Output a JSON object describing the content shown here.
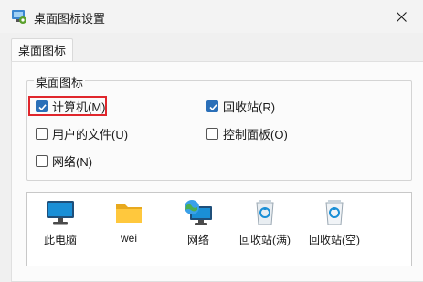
{
  "window": {
    "title": "桌面图标设置"
  },
  "tabs": [
    {
      "label": "桌面图标"
    }
  ],
  "group": {
    "title": "桌面图标",
    "checkboxes": [
      {
        "label": "计算机(M)",
        "checked": true
      },
      {
        "label": "回收站(R)",
        "checked": true
      },
      {
        "label": "用户的文件(U)",
        "checked": false
      },
      {
        "label": "控制面板(O)",
        "checked": false
      },
      {
        "label": "网络(N)",
        "checked": false
      }
    ]
  },
  "icons": [
    {
      "label": "此电脑",
      "icon": "monitor-icon"
    },
    {
      "label": "wei",
      "icon": "folder-icon"
    },
    {
      "label": "网络",
      "icon": "network-globe-icon"
    },
    {
      "label": "回收站(满)",
      "icon": "recycle-bin-full-icon"
    },
    {
      "label": "回收站(空)",
      "icon": "recycle-bin-empty-icon"
    }
  ],
  "colors": {
    "accent": "#2a6fb8",
    "highlight": "#e0262c"
  }
}
